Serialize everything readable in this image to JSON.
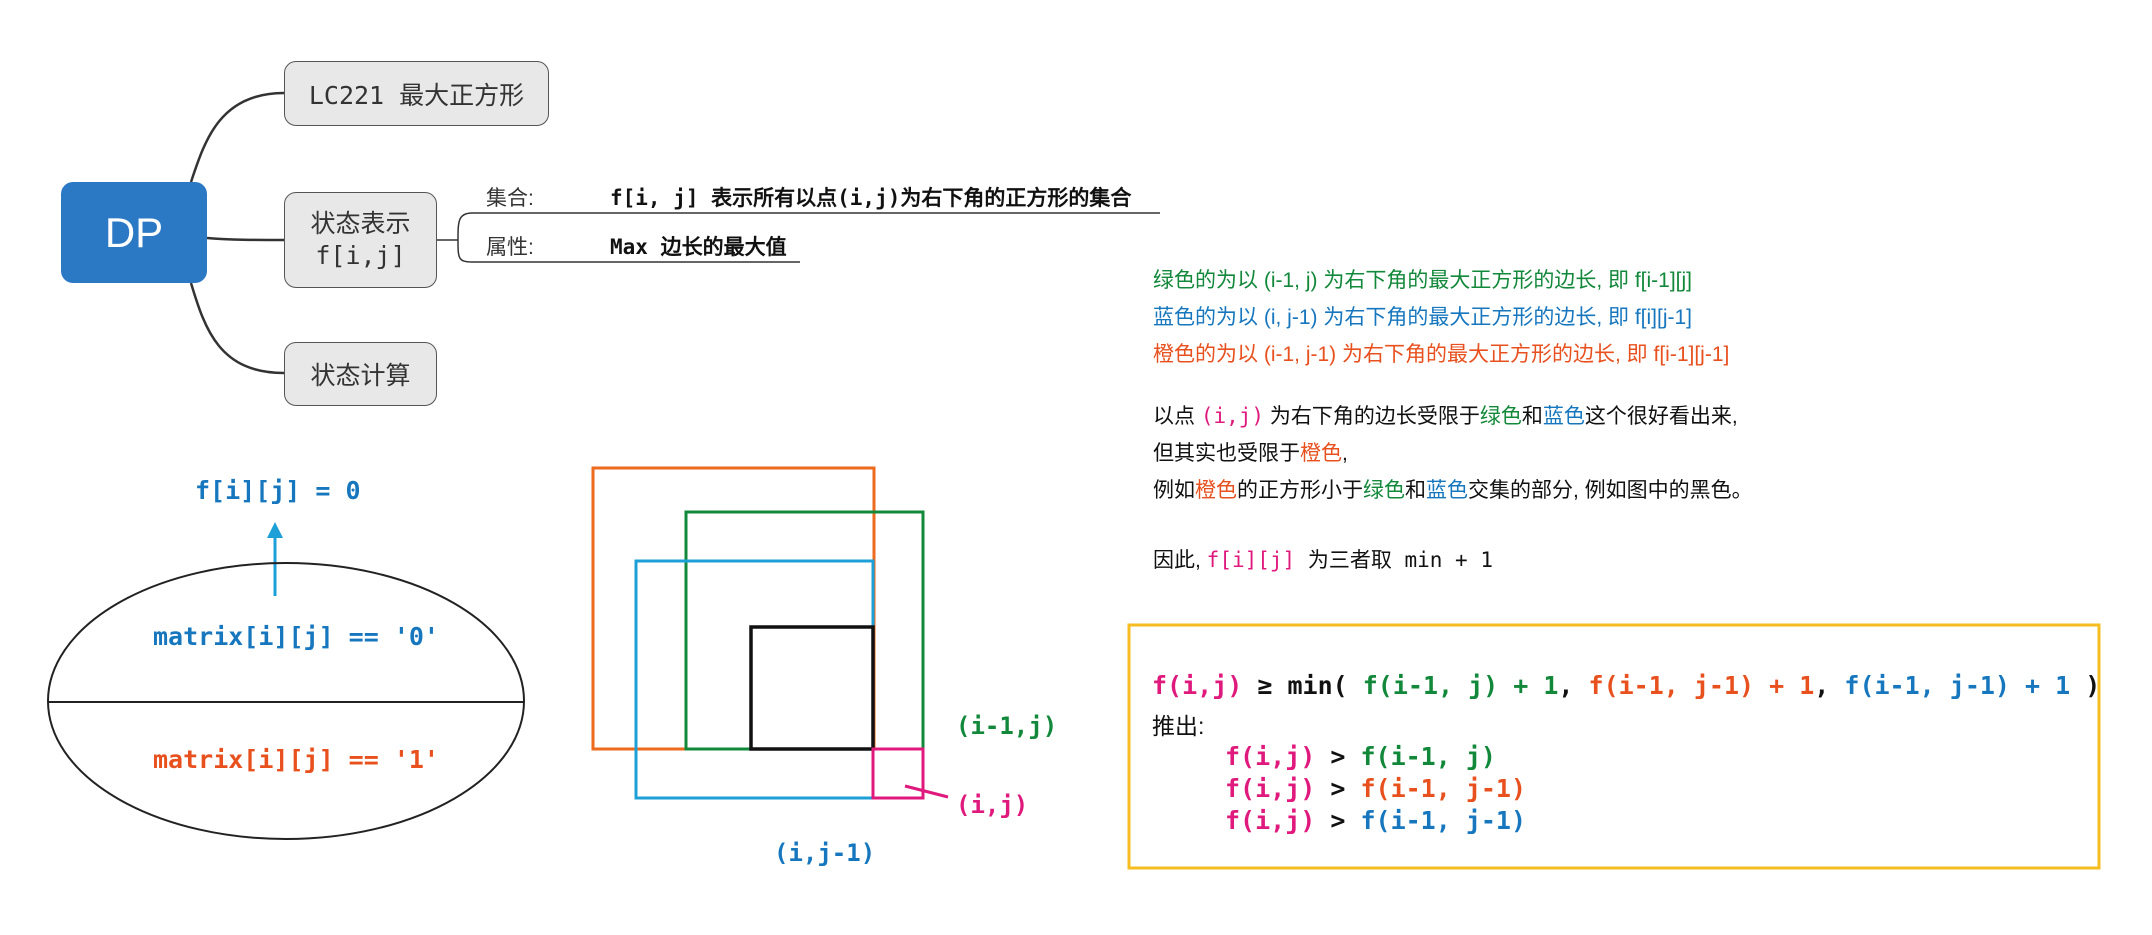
{
  "mindmap": {
    "root": "DP",
    "title_node": "LC221 最大正方形",
    "state_node": [
      "状态表示",
      "f[i,j]"
    ],
    "calc_node": "状态计算",
    "set_label": "集合:",
    "set_text": "f[i, j] 表示所有以点(i,j)为右下角的正方形的集合",
    "prop_label": "属性:",
    "prop_text": "Max 边长的最大值"
  },
  "ellipse": {
    "top_label": "f[i][j] = 0",
    "upper_text": "matrix[i][j] == '0'",
    "lower_text": "matrix[i][j] == '1'"
  },
  "squares": {
    "label_top": "(i-1,j)",
    "label_diag": "(i,j)",
    "label_left": "(i,j-1)"
  },
  "notes": {
    "green_line": "绿色的为以 (i-1, j) 为右下角的最大正方形的边长, 即 f[i-1][j]",
    "blue_line": "蓝色的为以 (i, j-1) 为右下角的最大正方形的边长, 即 f[i][j-1]",
    "orange_line": "橙色的为以 (i-1, j-1) 为右下角的最大正方形的边长, 即 f[i-1][j-1]",
    "p1": {
      "a": "以点 ",
      "b": "(i,j)",
      "c": " 为右下角的边长受限于",
      "d": "绿色",
      "e": "和",
      "f": "蓝色",
      "g": "这个很好看出来,"
    },
    "p2": {
      "a": "但其实也受限于",
      "b": "橙色",
      "c": ","
    },
    "p3": {
      "a": "例如",
      "b": "橙色",
      "c": "的正方形小于",
      "d": "绿色",
      "e": "和",
      "f": "蓝色",
      "g": "交集的部分, 例如图中的黑色。"
    },
    "p4": {
      "a": "因此, ",
      "b": "f[i][j]",
      "c": " 为三者取 min + 1"
    }
  },
  "formula": {
    "l1": {
      "a": "f(i,j)",
      "b": " ≥ min( ",
      "c": "f(i-1, j) + 1",
      "d": ", ",
      "e": "f(i-1, j-1) + 1",
      "f": ", ",
      "g": "f(i-1, j-1) + 1",
      "h": " )"
    },
    "derive": "推出:",
    "rows": [
      {
        "lhs": "f(i,j)",
        "op": " > ",
        "rhs": "f(i-1, j)"
      },
      {
        "lhs": "f(i,j)",
        "op": " > ",
        "rhs": "f(i-1, j-1)"
      },
      {
        "lhs": "f(i,j)",
        "op": " > ",
        "rhs": "f(i-1, j-1)"
      }
    ]
  },
  "colors": {
    "dp_node": "#2b78c5",
    "green": "#12883a",
    "blue": "#1677be",
    "orange": "#e8501e",
    "pink": "#e0197d",
    "light_blue": "#1da0d8",
    "square_orange": "#ee6a1c",
    "yellow_border": "#f5bd1f"
  }
}
